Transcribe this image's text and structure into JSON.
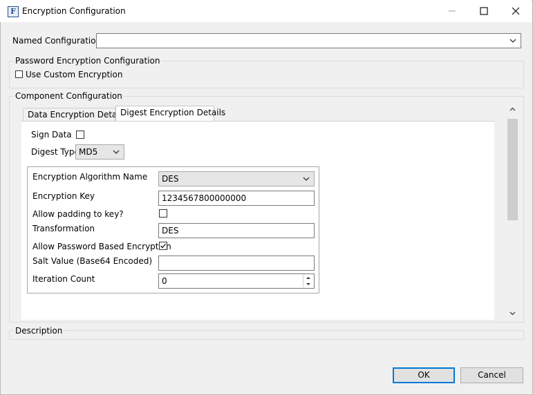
{
  "window": {
    "title": "Encryption Configuration",
    "min_label": "—",
    "max_label": "☐",
    "close_label": "✕"
  },
  "named_config": {
    "label": "Named Configuration",
    "value": ""
  },
  "password_group": {
    "title": "Password Encryption Configuration",
    "use_custom_label": "Use Custom Encryption",
    "use_custom_checked": false
  },
  "component_group": {
    "title": "Component Configuration"
  },
  "tabs": [
    {
      "label": "Data Encryption Details",
      "active": false
    },
    {
      "label": "Digest Encryption Details",
      "active": true
    }
  ],
  "digest": {
    "sign_data_label": "Sign Data",
    "sign_data_checked": false,
    "digest_type_label": "Digest Type",
    "digest_type_value": "MD5"
  },
  "details": {
    "algorithm_label": "Encryption Algorithm Name",
    "algorithm_value": "DES",
    "key_label": "Encryption Key",
    "key_value": "1234567800000000",
    "padding_label": "Allow padding to key?",
    "padding_checked": false,
    "transformation_label": "Transformation",
    "transformation_value": "DES",
    "pbe_label": "Allow Password Based Encryption",
    "pbe_checked": true,
    "salt_label": "Salt Value (Base64 Encoded)",
    "salt_value": "",
    "iteration_label": "Iteration Count",
    "iteration_value": "0"
  },
  "description": {
    "title": "Description"
  },
  "buttons": {
    "ok": "OK",
    "cancel": "Cancel"
  }
}
